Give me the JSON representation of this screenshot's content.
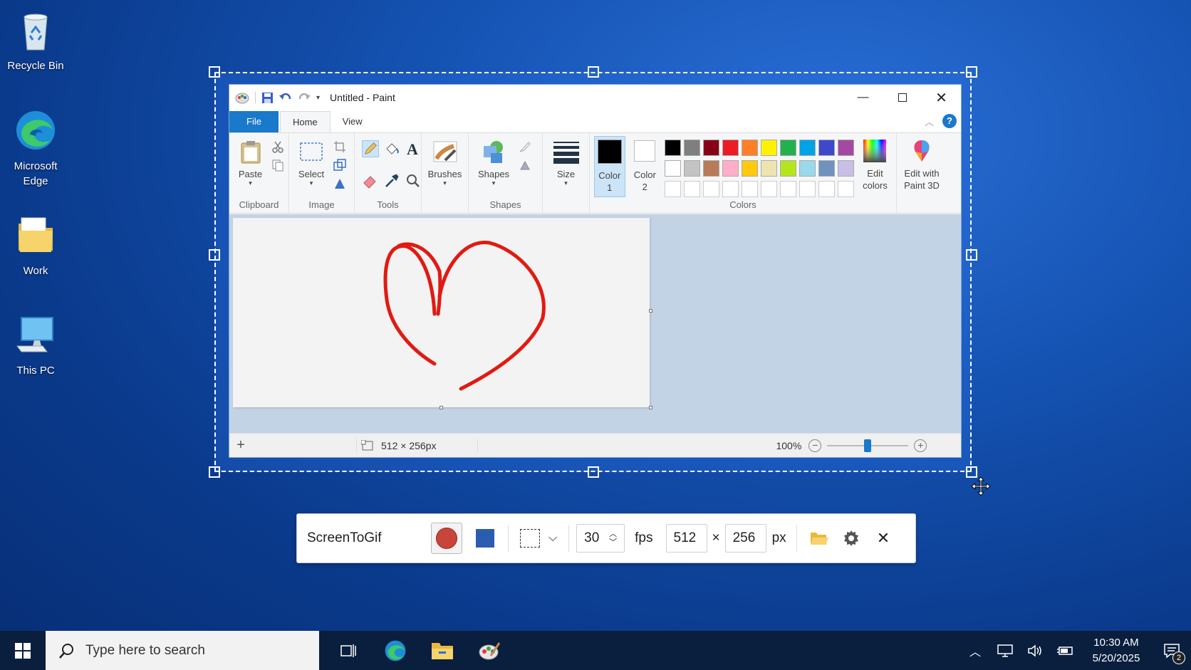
{
  "desktop": {
    "icons": [
      {
        "label": "Recycle Bin",
        "icon": "recycle-bin-icon"
      },
      {
        "label": "Microsoft Edge",
        "icon": "edge-icon"
      },
      {
        "label": "Work",
        "icon": "folder-icon"
      },
      {
        "label": "This PC",
        "icon": "computer-icon"
      }
    ]
  },
  "paint": {
    "title": "Untitled - Paint",
    "tabs": {
      "file": "File",
      "home": "Home",
      "view": "View"
    },
    "ribbon": {
      "clipboard": {
        "paste": "Paste",
        "group": "Clipboard"
      },
      "image": {
        "select": "Select",
        "group": "Image"
      },
      "tools": {
        "group": "Tools"
      },
      "brushes": {
        "label": "Brushes"
      },
      "shapes": {
        "label": "Shapes",
        "group": "Shapes"
      },
      "size": {
        "label": "Size"
      },
      "color1": {
        "line1": "Color",
        "line2": "1",
        "value": "#000000"
      },
      "color2": {
        "line1": "Color",
        "line2": "2",
        "value": "#ffffff"
      },
      "colors_group": "Colors",
      "edit_colors": {
        "line1": "Edit",
        "line2": "colors"
      },
      "paint3d": {
        "line1": "Edit with",
        "line2": "Paint 3D"
      },
      "palette": [
        "#000000",
        "#7f7f7f",
        "#880015",
        "#ed1c24",
        "#ff7f27",
        "#fff200",
        "#22b14c",
        "#00a2e8",
        "#3f48cc",
        "#a349a4",
        "#ffffff",
        "#c3c3c3",
        "#b97a57",
        "#ffaec9",
        "#ffc90e",
        "#efe4b0",
        "#b5e61d",
        "#99d9ea",
        "#7092be",
        "#c8bfe7",
        "#ffffff",
        "#ffffff",
        "#ffffff",
        "#ffffff",
        "#ffffff",
        "#ffffff",
        "#ffffff",
        "#ffffff",
        "#ffffff",
        "#ffffff"
      ]
    },
    "status": {
      "size": "512 × 256px",
      "zoom": "100%",
      "zoom_level": 0.5
    },
    "drawing_color": "#e01b12"
  },
  "screentogif": {
    "title": "ScreenToGif",
    "fps": "30",
    "fps_label": "fps",
    "width": "512",
    "times": "×",
    "height": "256",
    "unit": "px"
  },
  "taskbar": {
    "search_placeholder": "Type here to search",
    "time": "10:30 AM",
    "date": "5/20/2025",
    "notification_count": "2"
  }
}
